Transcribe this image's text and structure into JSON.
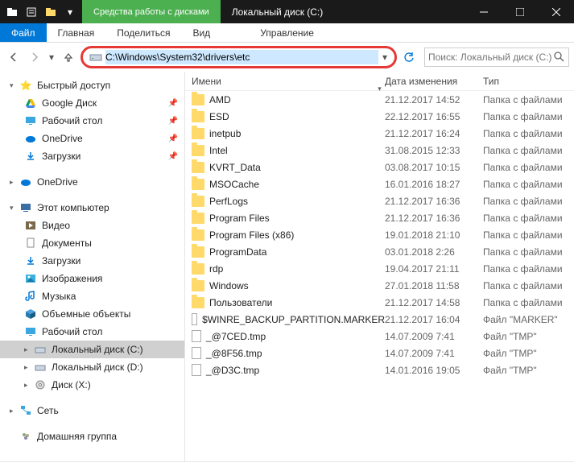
{
  "titlebar": {
    "tools_label": "Средства работы с дисками",
    "title": "Локальный диск (C:)"
  },
  "ribbon": {
    "file": "Файл",
    "home": "Главная",
    "share": "Поделиться",
    "view": "Вид",
    "manage": "Управление"
  },
  "address": {
    "path": "C:\\Windows\\System32\\drivers\\etc"
  },
  "search": {
    "placeholder": "Поиск: Локальный диск (C:)"
  },
  "columns": {
    "name": "Имени",
    "date": "Дата изменения",
    "type": "Тип"
  },
  "sidebar": {
    "quick": "Быстрый доступ",
    "gdrive": "Google Диск",
    "desktop": "Рабочий стол",
    "onedrive": "OneDrive",
    "downloads": "Загрузки",
    "onedrive2": "OneDrive",
    "thispc": "Этот компьютер",
    "video": "Видео",
    "documents": "Документы",
    "downloads2": "Загрузки",
    "images": "Изображения",
    "music": "Музыка",
    "objects3d": "Объемные объекты",
    "desktop2": "Рабочий стол",
    "diskc": "Локальный диск (C:)",
    "diskd": "Локальный диск (D:)",
    "diskx": "Диск (X:)",
    "network": "Сеть",
    "homegroup": "Домашняя группа"
  },
  "files": [
    {
      "name": "AMD",
      "date": "21.12.2017 14:52",
      "type": "Папка с файлами",
      "kind": "folder"
    },
    {
      "name": "ESD",
      "date": "22.12.2017 16:55",
      "type": "Папка с файлами",
      "kind": "folder"
    },
    {
      "name": "inetpub",
      "date": "21.12.2017 16:24",
      "type": "Папка с файлами",
      "kind": "folder"
    },
    {
      "name": "Intel",
      "date": "31.08.2015 12:33",
      "type": "Папка с файлами",
      "kind": "folder"
    },
    {
      "name": "KVRT_Data",
      "date": "03.08.2017 10:15",
      "type": "Папка с файлами",
      "kind": "folder"
    },
    {
      "name": "MSOCache",
      "date": "16.01.2016 18:27",
      "type": "Папка с файлами",
      "kind": "folder"
    },
    {
      "name": "PerfLogs",
      "date": "21.12.2017 16:36",
      "type": "Папка с файлами",
      "kind": "folder"
    },
    {
      "name": "Program Files",
      "date": "21.12.2017 16:36",
      "type": "Папка с файлами",
      "kind": "folder"
    },
    {
      "name": "Program Files (x86)",
      "date": "19.01.2018 21:10",
      "type": "Папка с файлами",
      "kind": "folder"
    },
    {
      "name": "ProgramData",
      "date": "03.01.2018 2:26",
      "type": "Папка с файлами",
      "kind": "folder"
    },
    {
      "name": "rdp",
      "date": "19.04.2017 21:11",
      "type": "Папка с файлами",
      "kind": "folder"
    },
    {
      "name": "Windows",
      "date": "27.01.2018 11:58",
      "type": "Папка с файлами",
      "kind": "folder"
    },
    {
      "name": "Пользователи",
      "date": "21.12.2017 14:58",
      "type": "Папка с файлами",
      "kind": "folder"
    },
    {
      "name": "$WINRE_BACKUP_PARTITION.MARKER",
      "date": "21.12.2017 16:04",
      "type": "Файл \"MARKER\"",
      "kind": "file"
    },
    {
      "name": "_@7CED.tmp",
      "date": "14.07.2009 7:41",
      "type": "Файл \"TMP\"",
      "kind": "file"
    },
    {
      "name": "_@8F56.tmp",
      "date": "14.07.2009 7:41",
      "type": "Файл \"TMP\"",
      "kind": "file"
    },
    {
      "name": "_@D3C.tmp",
      "date": "14.01.2016 19:05",
      "type": "Файл \"TMP\"",
      "kind": "file"
    }
  ]
}
